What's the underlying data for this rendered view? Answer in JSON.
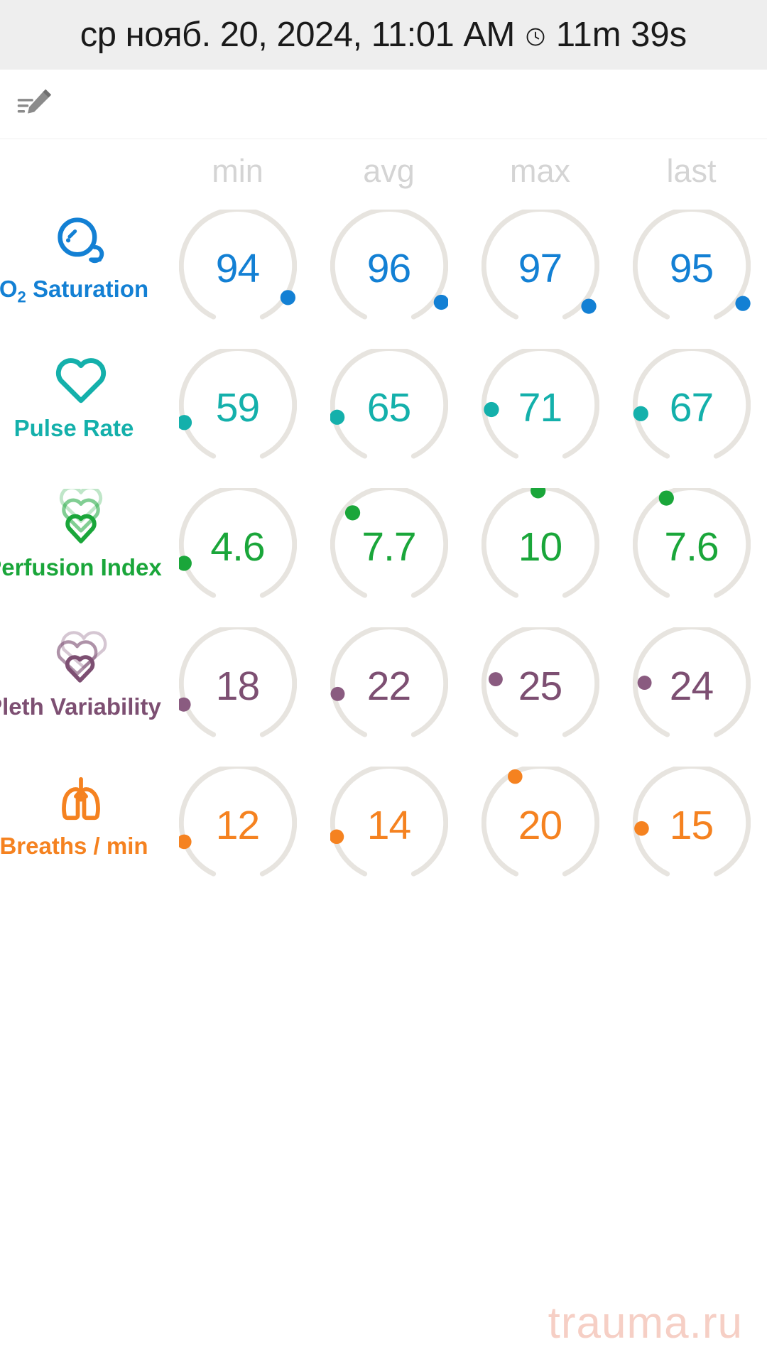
{
  "header": {
    "datetime": "ср нояб. 20, 2024, 11:01 AM",
    "clock_icon": "clock-icon",
    "duration": "11m 39s",
    "background_color": "#eeeeee"
  },
  "toolbar": {
    "edit_note_icon": "edit-note-icon"
  },
  "table": {
    "columns": [
      "min",
      "avg",
      "max",
      "last"
    ],
    "column_header_color": "#d4d4d4",
    "track_color": "#e7e4df",
    "rows": [
      {
        "label": "O₂ Saturation",
        "label_main": "Saturation",
        "label_prefix": "O",
        "label_sub": "2",
        "icon": "o2-bubble-icon",
        "color": "#1380d4",
        "values": [
          "94",
          "96",
          "97",
          "95"
        ],
        "dot_angles": [
          118,
          122,
          126,
          120
        ]
      },
      {
        "label": "Pulse Rate",
        "icon": "heart-outline-icon",
        "color": "#14b0ab",
        "values": [
          "59",
          "65",
          "71",
          "67"
        ],
        "dot_angles": [
          -118,
          -112,
          -104,
          -108
        ]
      },
      {
        "label": "Perfusion Index",
        "icon": "nested-hearts-green-icon",
        "color": "#1aa63a",
        "values": [
          "4.6",
          "7.7",
          "10",
          "7.6"
        ],
        "dot_angles": [
          -122,
          -62,
          -18,
          -40
        ]
      },
      {
        "label": "Pleth Variability",
        "icon": "nested-hearts-purple-icon",
        "color": "#7d4f72",
        "values": [
          "18",
          "22",
          "25",
          "24"
        ],
        "dot_angles": [
          -124,
          -104,
          -78,
          -84
        ]
      },
      {
        "label": "Breaths / min",
        "icon": "lungs-icon",
        "color": "#f58220",
        "values": [
          "12",
          "14",
          "20",
          "15"
        ],
        "dot_angles": [
          -122,
          -114,
          -40,
          -100
        ]
      }
    ]
  },
  "watermark": {
    "text": "trauma.ru",
    "color": "#f6cfc5"
  }
}
